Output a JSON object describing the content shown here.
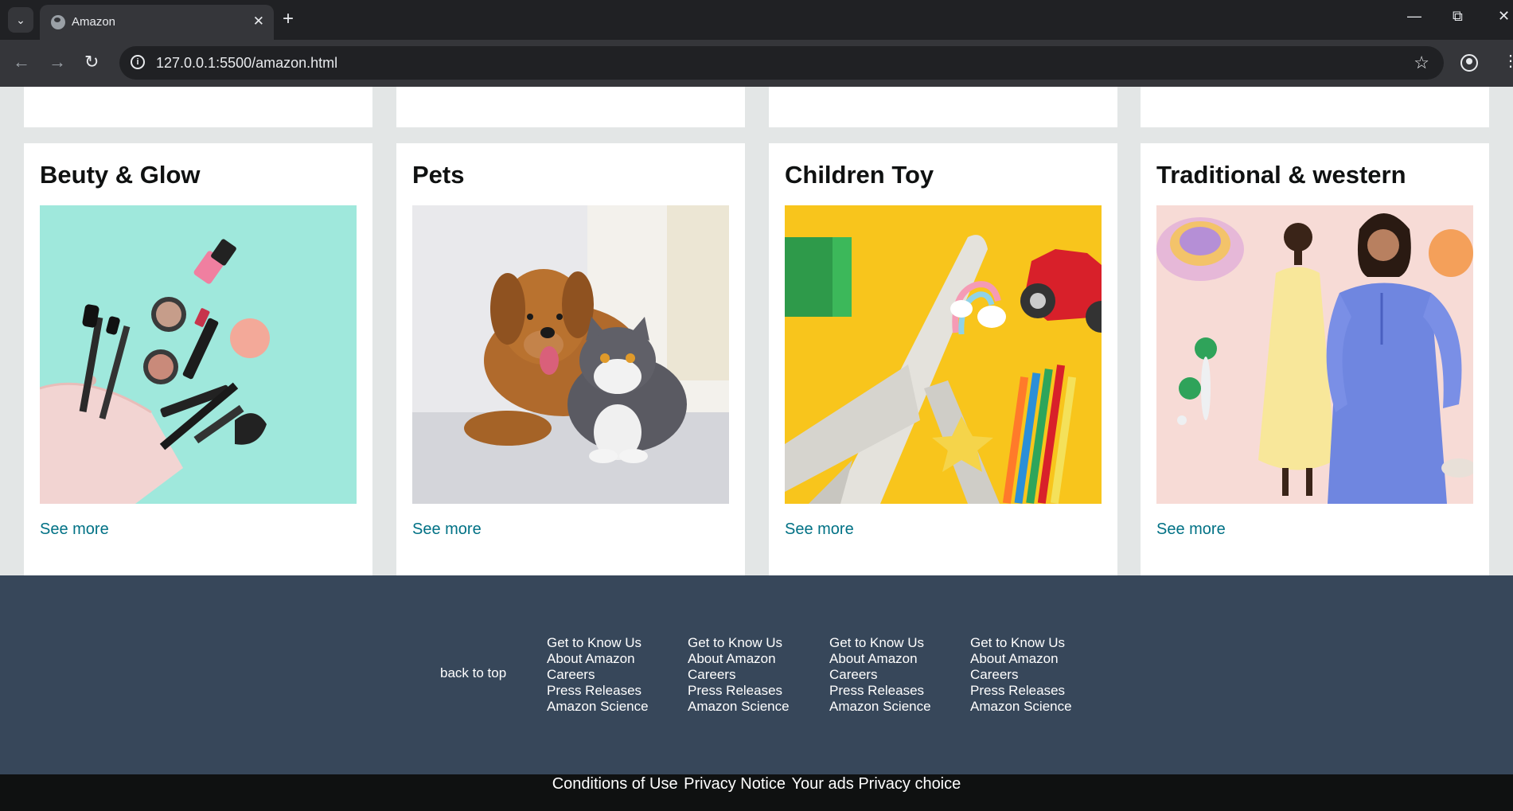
{
  "browser": {
    "tab_title": "Amazon",
    "url": "127.0.0.1:5500/amazon.html"
  },
  "cards": [
    {
      "title": "Beuty & Glow",
      "link": "See more"
    },
    {
      "title": "Pets",
      "link": "See more"
    },
    {
      "title": "Children Toy",
      "link": "See more"
    },
    {
      "title": "Traditional & western",
      "link": "See more"
    }
  ],
  "footer": {
    "back_to_top": "back to top",
    "columns": [
      {
        "items": [
          "Get to Know Us",
          "About Amazon",
          "Careers",
          "Press Releases",
          "Amazon Science"
        ]
      },
      {
        "items": [
          "Get to Know Us",
          "About Amazon",
          "Careers",
          "Press Releases",
          "Amazon Science"
        ]
      },
      {
        "items": [
          "Get to Know Us",
          "About Amazon",
          "Careers",
          "Press Releases",
          "Amazon Science"
        ]
      },
      {
        "items": [
          "Get to Know Us",
          "About Amazon",
          "Careers",
          "Press Releases",
          "Amazon Science"
        ]
      }
    ]
  },
  "bottom_links": [
    "Conditions of Use",
    "Privacy Notice",
    "Your ads Privacy choice"
  ]
}
